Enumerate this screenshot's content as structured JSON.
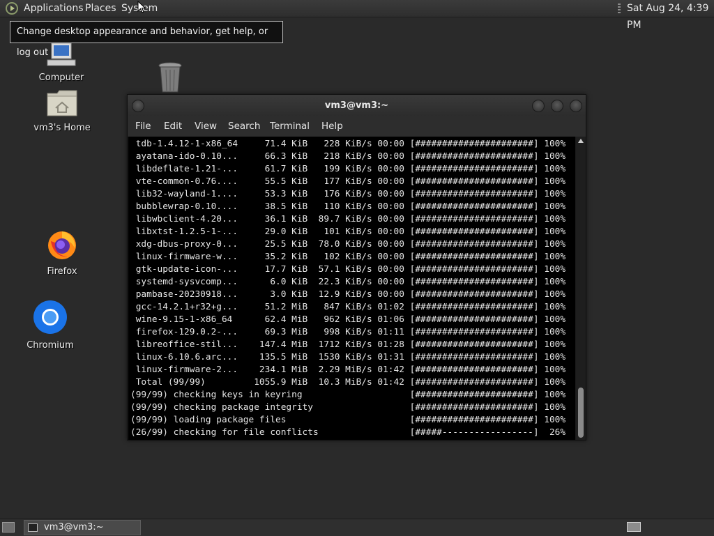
{
  "top_panel": {
    "menus": [
      "Applications",
      "Places",
      "System"
    ],
    "clock": "Sat Aug 24,  4:39 PM"
  },
  "tooltip": {
    "text": "Change desktop appearance and behavior, get help, or log out"
  },
  "desktop_icons": [
    {
      "label": "Computer",
      "icon": "computer-icon"
    },
    {
      "label": "",
      "icon": "trash-icon"
    },
    {
      "label": "vm3's Home",
      "icon": "home-folder-icon"
    },
    {
      "label": "Firefox",
      "icon": "firefox-icon"
    },
    {
      "label": "Chromium",
      "icon": "chromium-icon"
    }
  ],
  "terminal": {
    "title": "vm3@vm3:~",
    "menu": [
      "File",
      "Edit",
      "View",
      "Search",
      "Terminal",
      "Help"
    ],
    "output": " tdb-1.4.12-1-x86_64     71.4 KiB   228 KiB/s 00:00 [######################] 100%\n ayatana-ido-0.10...     66.3 KiB   218 KiB/s 00:00 [######################] 100%\n libdeflate-1.21-...     61.7 KiB   199 KiB/s 00:00 [######################] 100%\n vte-common-0.76....     55.5 KiB   177 KiB/s 00:00 [######################] 100%\n lib32-wayland-1....     53.3 KiB   176 KiB/s 00:00 [######################] 100%\n bubblewrap-0.10....     38.5 KiB   110 KiB/s 00:00 [######################] 100%\n libwbclient-4.20...     36.1 KiB  89.7 KiB/s 00:00 [######################] 100%\n libxtst-1.2.5-1-...     29.0 KiB   101 KiB/s 00:00 [######################] 100%\n xdg-dbus-proxy-0...     25.5 KiB  78.0 KiB/s 00:00 [######################] 100%\n linux-firmware-w...     35.2 KiB   102 KiB/s 00:00 [######################] 100%\n gtk-update-icon-...     17.7 KiB  57.1 KiB/s 00:00 [######################] 100%\n systemd-sysvcomp...      6.0 KiB  22.3 KiB/s 00:00 [######################] 100%\n pambase-20230918...      3.0 KiB  12.9 KiB/s 00:00 [######################] 100%\n gcc-14.2.1+r32+g...     51.2 MiB   847 KiB/s 01:02 [######################] 100%\n wine-9.15-1-x86_64      62.4 MiB   962 KiB/s 01:06 [######################] 100%\n firefox-129.0.2-...     69.3 MiB   998 KiB/s 01:11 [######################] 100%\n libreoffice-stil...    147.4 MiB  1712 KiB/s 01:28 [######################] 100%\n linux-6.10.6.arc...    135.5 MiB  1530 KiB/s 01:31 [######################] 100%\n linux-firmware-2...    234.1 MiB  2.29 MiB/s 01:42 [######################] 100%\n Total (99/99)         1055.9 MiB  10.3 MiB/s 01:42 [######################] 100%\n(99/99) checking keys in keyring                    [######################] 100%\n(99/99) checking package integrity                  [######################] 100%\n(99/99) loading package files                       [######################] 100%\n(26/99) checking for file conflicts                 [#####-----------------]  26%",
    "progress_fraction": 0.26
  },
  "bottom_panel": {
    "task_label": "vm3@vm3:~"
  }
}
